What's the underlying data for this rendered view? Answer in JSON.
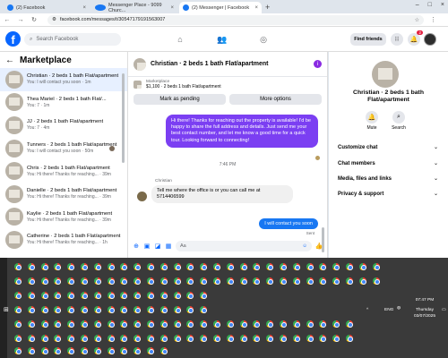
{
  "browser": {
    "tabs": [
      {
        "label": "(2) Facebook",
        "active": false
      },
      {
        "label": "Messenger Place - 9099 Churc...",
        "active": false
      },
      {
        "label": "(2) Messenger | Facebook",
        "active": true
      }
    ],
    "url": "facebook.com/messages/t/30547179191563007"
  },
  "fb": {
    "logo": "f",
    "search_placeholder": "Search Facebook",
    "find_friends": "Find friends",
    "notif_count": "2"
  },
  "sidebar": {
    "title": "Marketplace",
    "conversations": [
      {
        "title": "Christian · 2 beds 1 bath Flat/apartment",
        "sub": "You: I will contact you soon · 1m",
        "selected": true
      },
      {
        "title": "Thea Mariel · 2 beds 1 bath Flat/...",
        "sub": "You: 7 · 1m",
        "selected": false
      },
      {
        "title": "JJ · 2 beds 1 bath Flat/apartment",
        "sub": "You: 7 · 4m",
        "selected": false
      },
      {
        "title": "Tunners · 2 beds 1 bath Flat/apartment",
        "sub": "You: I will contact you soon · 50m",
        "selected": false
      },
      {
        "title": "Chris · 2 beds 1 bath Flat/apartment",
        "sub": "You: Hi there! Thanks for reaching... · 39m",
        "selected": false
      },
      {
        "title": "Danielle · 2 beds 1 bath Flat/apartment",
        "sub": "You: Hi there! Thanks for reaching... · 39m",
        "selected": false
      },
      {
        "title": "Kaylie · 2 beds 1 bath Flat/apartment",
        "sub": "You: Hi there! Thanks for reaching... · 39m",
        "selected": false
      },
      {
        "title": "Catherine · 2 beds 1 bath Flat/apartment",
        "sub": "You: Hi there! Thanks for reaching... · 1h",
        "selected": false
      }
    ]
  },
  "chat": {
    "title": "Christian · 2 beds 1 bath Flat/apartment",
    "marketplace_label": "Marketplace",
    "listing": "$1,100 · 2 beds 1 bath Flat/apartment",
    "mark_pending": "Mark as pending",
    "more_options": "More options",
    "msg_out": "Hi there! Thanks for reaching out the property is available! I'd be happy to share the full address and details. Just send me your best contact number, and let me know a good time for a quick tour. Looking forward to connecting!",
    "time": "7:46 PM",
    "sender": "Christian",
    "msg_in": "Tell me where the office is or you can call me at 5714406599",
    "msg_out2": "I will contact you soon",
    "sent": "Sent",
    "composer_placeholder": "Aa"
  },
  "info": {
    "name": "Christian · 2 beds 1 bath Flat/apartment",
    "mute": "Mute",
    "search": "Search",
    "items": [
      "Customize chat",
      "Chat members",
      "Media, files and links",
      "Privacy & support"
    ]
  },
  "taskbar": {
    "time": "07:47 PM",
    "day": "Thursday",
    "date": "03/07/2025",
    "lang": "ENG"
  },
  "colors": {
    "fb_blue": "#0866ff",
    "out_bubble": "#7b3ff2",
    "out_bubble2": "#1877f2"
  }
}
